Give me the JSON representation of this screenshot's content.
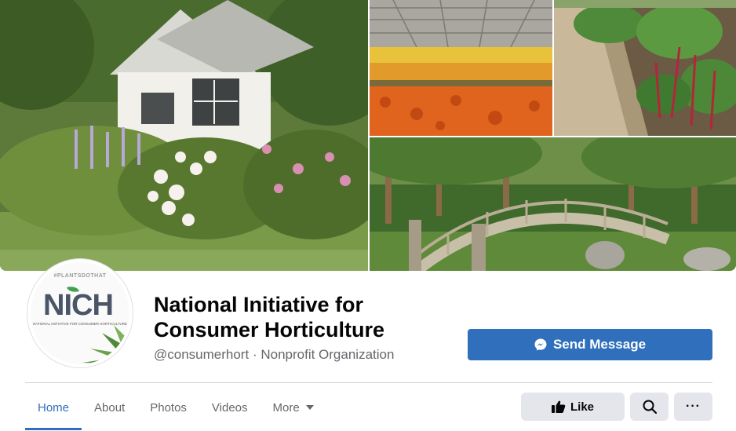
{
  "page": {
    "name": "National Initiative for Consumer Horticulture",
    "handle": "@consumerhort",
    "separator": "·",
    "category": "Nonprofit Organization"
  },
  "avatar": {
    "hashtag": "#PLANTSDOTHAT",
    "logo_text": "NICH",
    "logo_tagline": "NATIONAL INITIATIVE FOR CONSUMER HORTICULTURE"
  },
  "cover": {
    "tiles": [
      "house-garden-photo",
      "greenhouse-flowers-photo",
      "raised-bed-chard-photo",
      "garden-bridge-photo"
    ]
  },
  "actions": {
    "send_message": "Send Message",
    "like": "Like",
    "search_icon": "search-icon",
    "more_icon": "more-dots-icon",
    "more_text": "···"
  },
  "tabs": [
    {
      "label": "Home",
      "active": true
    },
    {
      "label": "About",
      "active": false
    },
    {
      "label": "Photos",
      "active": false
    },
    {
      "label": "Videos",
      "active": false
    },
    {
      "label": "More",
      "active": false
    }
  ],
  "colors": {
    "accent": "#2f6fbc",
    "button_gray": "#e4e6eb",
    "meta_text": "#65676b"
  }
}
